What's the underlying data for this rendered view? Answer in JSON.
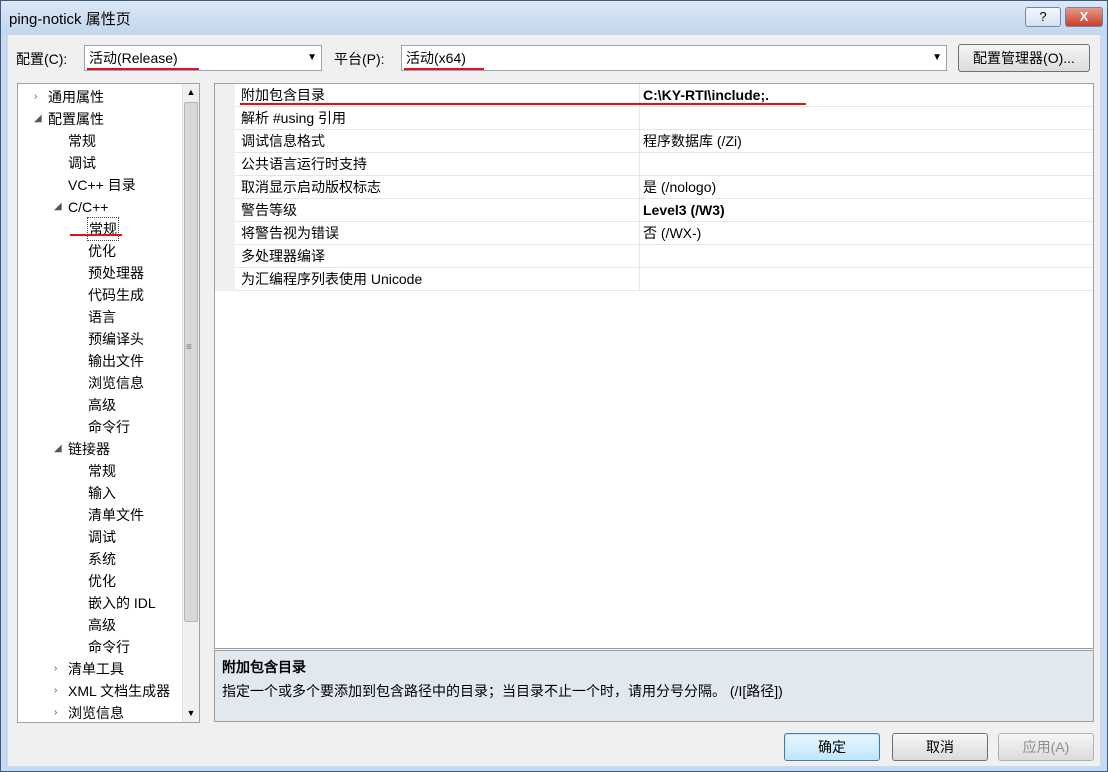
{
  "window": {
    "title": "ping-notick 属性页",
    "help_label": "?",
    "close_label": "X"
  },
  "config": {
    "label": "配置(C):",
    "value": "活动(Release)"
  },
  "platform": {
    "label": "平台(P):",
    "value": "活动(x64)"
  },
  "config_manager_label": "配置管理器(O)...",
  "tree": [
    {
      "label": "通用属性",
      "toggle": "›",
      "level": 0
    },
    {
      "label": "配置属性",
      "toggle": "◢",
      "level": 0
    },
    {
      "label": "常规",
      "toggle": "",
      "level": 1
    },
    {
      "label": "调试",
      "toggle": "",
      "level": 1
    },
    {
      "label": "VC++ 目录",
      "toggle": "",
      "level": 1
    },
    {
      "label": "C/C++",
      "toggle": "◢",
      "level": 1
    },
    {
      "label": "常规",
      "toggle": "",
      "level": 2,
      "selected": true
    },
    {
      "label": "优化",
      "toggle": "",
      "level": 2
    },
    {
      "label": "预处理器",
      "toggle": "",
      "level": 2
    },
    {
      "label": "代码生成",
      "toggle": "",
      "level": 2
    },
    {
      "label": "语言",
      "toggle": "",
      "level": 2
    },
    {
      "label": "预编译头",
      "toggle": "",
      "level": 2
    },
    {
      "label": "输出文件",
      "toggle": "",
      "level": 2
    },
    {
      "label": "浏览信息",
      "toggle": "",
      "level": 2
    },
    {
      "label": "高级",
      "toggle": "",
      "level": 2
    },
    {
      "label": "命令行",
      "toggle": "",
      "level": 2
    },
    {
      "label": "链接器",
      "toggle": "◢",
      "level": 1
    },
    {
      "label": "常规",
      "toggle": "",
      "level": 2
    },
    {
      "label": "输入",
      "toggle": "",
      "level": 2
    },
    {
      "label": "清单文件",
      "toggle": "",
      "level": 2
    },
    {
      "label": "调试",
      "toggle": "",
      "level": 2
    },
    {
      "label": "系统",
      "toggle": "",
      "level": 2
    },
    {
      "label": "优化",
      "toggle": "",
      "level": 2
    },
    {
      "label": "嵌入的 IDL",
      "toggle": "",
      "level": 2
    },
    {
      "label": "高级",
      "toggle": "",
      "level": 2
    },
    {
      "label": "命令行",
      "toggle": "",
      "level": 2
    },
    {
      "label": "清单工具",
      "toggle": "›",
      "level": 1
    },
    {
      "label": "XML 文档生成器",
      "toggle": "›",
      "level": 1
    },
    {
      "label": "浏览信息",
      "toggle": "›",
      "level": 1
    }
  ],
  "properties": [
    {
      "name": "附加包含目录",
      "value": "C:\\KY-RTI\\include;.",
      "bold": true
    },
    {
      "name": "解析 #using 引用",
      "value": "",
      "bold": false
    },
    {
      "name": "调试信息格式",
      "value": "程序数据库 (/Zi)",
      "bold": false
    },
    {
      "name": "公共语言运行时支持",
      "value": "",
      "bold": false
    },
    {
      "name": "取消显示启动版权标志",
      "value": "是 (/nologo)",
      "bold": false
    },
    {
      "name": "警告等级",
      "value": "Level3 (/W3)",
      "bold": true
    },
    {
      "name": "将警告视为错误",
      "value": "否 (/WX-)",
      "bold": false
    },
    {
      "name": "多处理器编译",
      "value": "",
      "bold": false
    },
    {
      "name": "为汇编程序列表使用 Unicode",
      "value": "",
      "bold": false
    }
  ],
  "description": {
    "title": "附加包含目录",
    "text": "指定一个或多个要添加到包含路径中的目录；当目录不止一个时，请用分号分隔。     (/I[路径])"
  },
  "buttons": {
    "ok": "确定",
    "cancel": "取消",
    "apply": "应用(A)"
  },
  "colors": {
    "annotation": "#e0101e",
    "window_frame": "#c9daf0",
    "description_bg": "#e2e8ef"
  }
}
